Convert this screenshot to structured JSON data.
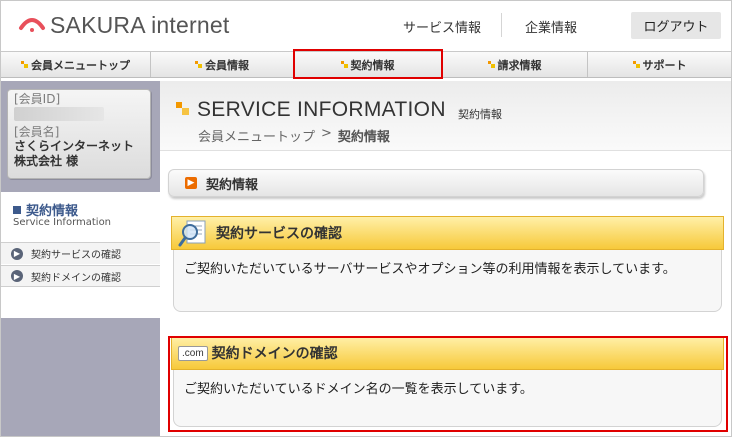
{
  "header": {
    "logo_text": "SAKURA internet",
    "nav": [
      "サービス情報",
      "企業情報"
    ],
    "logout_label": "ログアウト"
  },
  "menubar": {
    "items": [
      {
        "label": "会員メニュートップ"
      },
      {
        "label": "会員情報"
      },
      {
        "label": "契約情報",
        "active": true
      },
      {
        "label": "請求情報"
      },
      {
        "label": "サポート"
      }
    ]
  },
  "sidebar": {
    "member_id_label": "[会員ID]",
    "member_name_label": "[会員名]",
    "member_name_line1": "さくらインターネット",
    "member_name_line2": "株式会社 様",
    "section_title": "契約情報",
    "section_subtitle": "Service Information",
    "links": [
      "契約サービスの確認",
      "契約ドメインの確認"
    ]
  },
  "page": {
    "title": "SERVICE INFORMATION",
    "title_sub": "契約情報",
    "breadcrumb": [
      "会員メニュートップ",
      ">",
      "契約情報"
    ],
    "section_label": "契約情報"
  },
  "cards": [
    {
      "title": "契約サービスの確認",
      "body": "ご契約いただいているサーバサービスやオプション等の利用情報を表示しています。"
    },
    {
      "badge": ".com",
      "title": "契約ドメインの確認",
      "body": "ご契約いただいているドメイン名の一覧を表示しています。"
    }
  ],
  "colors": {
    "accent_orange": "#f39800",
    "highlight_red": "#e00000",
    "card_header_yellow": "#f7c93a",
    "sidebar_bg": "#a7a7b8"
  }
}
